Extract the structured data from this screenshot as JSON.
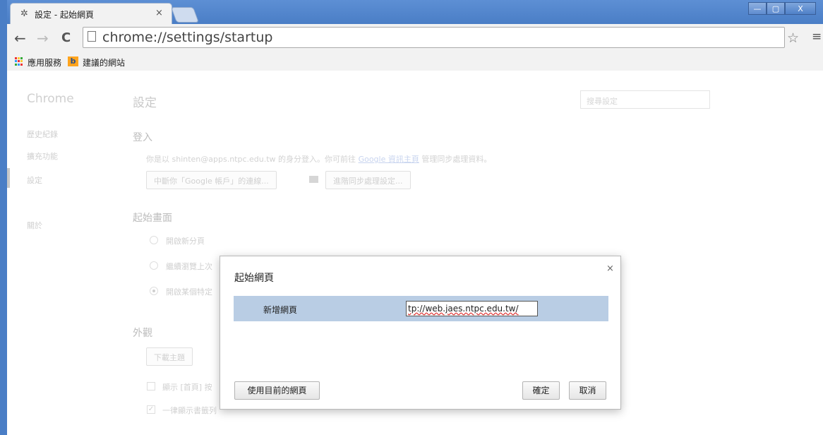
{
  "browser": {
    "tab": {
      "title": "設定 - 起始網頁",
      "close_glyph": "×",
      "icon": "gear-icon"
    },
    "window_controls": {
      "minimize": "—",
      "maximize": "▢",
      "close": "X"
    },
    "nav": {
      "back": "←",
      "forward": "→",
      "reload": "C"
    },
    "url": "chrome://settings/startup",
    "bookmarks": [
      {
        "label": "應用服務",
        "icon": "apps-icon"
      },
      {
        "label": "建議的網站",
        "icon": "bookmark-b-icon"
      }
    ]
  },
  "sidebar": {
    "brand": "Chrome",
    "items": [
      "歷史紀錄",
      "擴充功能",
      "設定",
      "關於"
    ],
    "active": "設定"
  },
  "settings": {
    "title": "設定",
    "search_placeholder": "搜尋設定",
    "signin": {
      "heading": "登入",
      "text_pre": "你是以 shinten@apps.ntpc.edu.tw 的身分登入。你可前往",
      "link": "Google 資訊主頁",
      "text_post": "管理同步處理資料。",
      "disconnect_button": "中斷你「Google 帳戶」的連線...",
      "advanced_sync_button": "進階同步處理設定..."
    },
    "startup": {
      "heading": "起始畫面",
      "options": [
        "開啟新分頁",
        "繼續瀏覽上次",
        "開啟某個特定"
      ]
    },
    "appearance": {
      "heading": "外觀",
      "theme_button": "下載主題",
      "show_home": "顯示 [首頁] 按",
      "always_show_bookmarks": "一律顯示書籤列"
    }
  },
  "dialog": {
    "title": "起始網頁",
    "close": "×",
    "row_label": "新增網頁",
    "input_value": "tp://web.jaes.ntpc.edu.tw/",
    "use_current_button": "使用目前的網頁",
    "ok_button": "確定",
    "cancel_button": "取消"
  },
  "colors": {
    "titlebar": "#4a7ec6",
    "dialog_row": "#b9cde4"
  }
}
